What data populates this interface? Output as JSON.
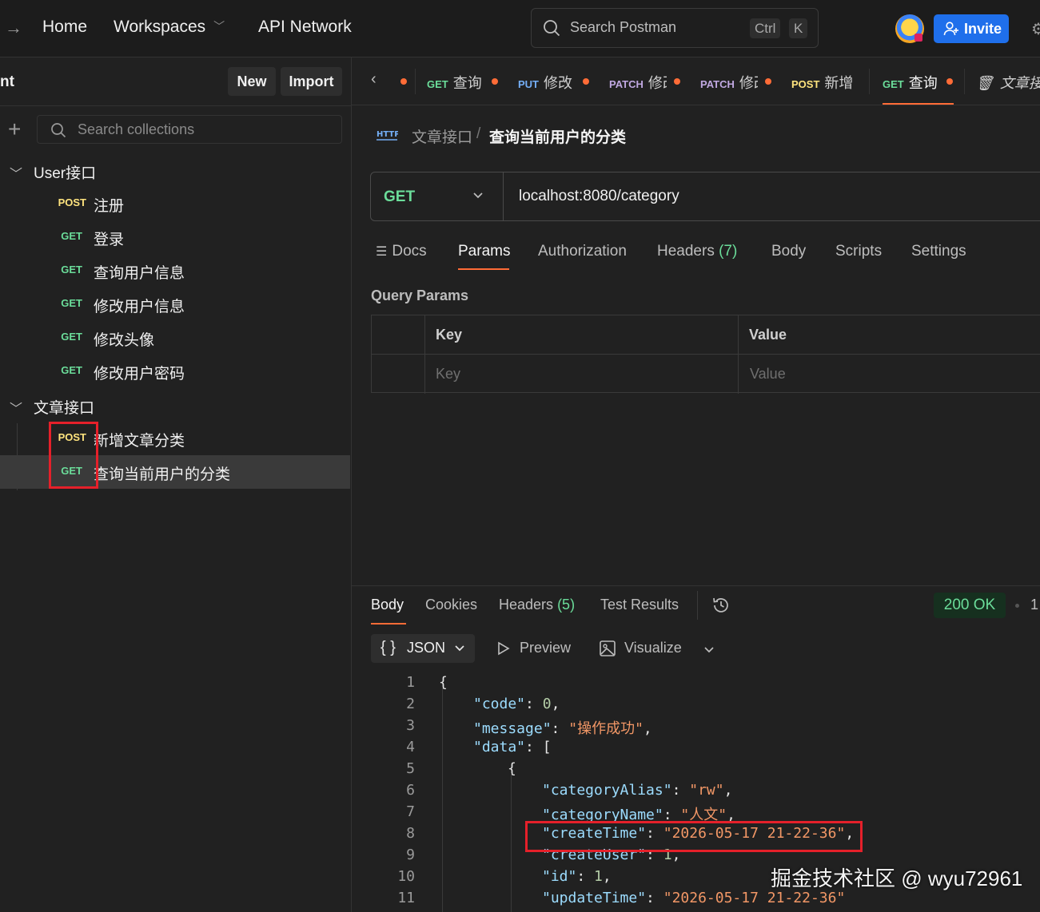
{
  "topbar": {
    "home": "Home",
    "workspaces": "Workspaces",
    "api_network": "API Network",
    "search_placeholder": "Search Postman",
    "shortcut_ctrl": "Ctrl",
    "shortcut_k": "K",
    "invite": "Invite"
  },
  "sidebar": {
    "workspace_title": "nt",
    "new_label": "New",
    "import_label": "Import",
    "search_placeholder": "Search collections",
    "folders": [
      {
        "name": "User接口",
        "requests": [
          {
            "method": "POST",
            "name": "注册"
          },
          {
            "method": "GET",
            "name": "登录"
          },
          {
            "method": "GET",
            "name": "查询用户信息"
          },
          {
            "method": "GET",
            "name": "修改用户信息"
          },
          {
            "method": "GET",
            "name": "修改头像"
          },
          {
            "method": "GET",
            "name": "修改用户密码"
          }
        ]
      },
      {
        "name": "文章接口",
        "requests": [
          {
            "method": "POST",
            "name": "新增文章分类"
          },
          {
            "method": "GET",
            "name": "查询当前用户的分类"
          }
        ]
      }
    ]
  },
  "tabs": [
    {
      "method": "GET",
      "name": "查询"
    },
    {
      "method": "PUT",
      "name": "修改"
    },
    {
      "method": "PATCH",
      "name": "修改"
    },
    {
      "method": "PATCH",
      "name": "修改"
    },
    {
      "method": "POST",
      "name": "新增"
    },
    {
      "method": "GET",
      "name": "查询"
    },
    {
      "method": "",
      "name": "文章接"
    }
  ],
  "breadcrumb": {
    "icon": "http-icon",
    "parent": "文章接口",
    "separator": "/",
    "title": "查询当前用户的分类"
  },
  "request": {
    "method": "GET",
    "url": "localhost:8080/category",
    "tabs": {
      "docs": "Docs",
      "params": "Params",
      "authorization": "Authorization",
      "headers": "Headers",
      "headers_count": "(7)",
      "body": "Body",
      "scripts": "Scripts",
      "settings": "Settings"
    },
    "query_params": {
      "title": "Query Params",
      "col_key": "Key",
      "col_value": "Value",
      "key_placeholder": "Key",
      "value_placeholder": "Value"
    }
  },
  "response": {
    "tabs": {
      "body": "Body",
      "cookies": "Cookies",
      "headers": "Headers",
      "headers_count": "(5)",
      "test_results": "Test Results"
    },
    "status": "200 OK",
    "status_more": "1",
    "format": "JSON",
    "format_braces": "{ }",
    "preview": "Preview",
    "visualize": "Visualize",
    "lines": [
      {
        "n": "1",
        "indent": 0,
        "text": "{"
      },
      {
        "n": "2",
        "indent": 1,
        "key": "\"code\"",
        "sep": ": ",
        "num": "0",
        "tail": ","
      },
      {
        "n": "3",
        "indent": 1,
        "key": "\"message\"",
        "sep": ": ",
        "str": "\"操作成功\"",
        "tail": ","
      },
      {
        "n": "4",
        "indent": 1,
        "key": "\"data\"",
        "sep": ": ",
        "tail": "["
      },
      {
        "n": "5",
        "indent": 2,
        "text": "{"
      },
      {
        "n": "6",
        "indent": 3,
        "key": "\"categoryAlias\"",
        "sep": ": ",
        "str": "\"rw\"",
        "tail": ","
      },
      {
        "n": "7",
        "indent": 3,
        "key": "\"categoryName\"",
        "sep": ": ",
        "str": "\"人文\"",
        "tail": ","
      },
      {
        "n": "8",
        "indent": 3,
        "key": "\"createTime\"",
        "sep": ": ",
        "str": "\"2026-05-17 21-22-36\"",
        "tail": ","
      },
      {
        "n": "9",
        "indent": 3,
        "key": "\"createUser\"",
        "sep": ": ",
        "num": "1",
        "tail": ","
      },
      {
        "n": "10",
        "indent": 3,
        "key": "\"id\"",
        "sep": ": ",
        "num": "1",
        "tail": ","
      },
      {
        "n": "11",
        "indent": 3,
        "key": "\"updateTime\"",
        "sep": ": ",
        "str": "\"2026-05-17 21-22-36\"",
        "tail": ""
      }
    ]
  },
  "watermark": "掘金技术社区 @ wyu72961",
  "colors": {
    "accent": "#ff6c37",
    "get": "#6bdd9a",
    "post": "#ffe47e",
    "put": "#74aef6",
    "patch": "#c0a8e1",
    "invite": "#1f6feb",
    "highlight": "#e5202a"
  }
}
